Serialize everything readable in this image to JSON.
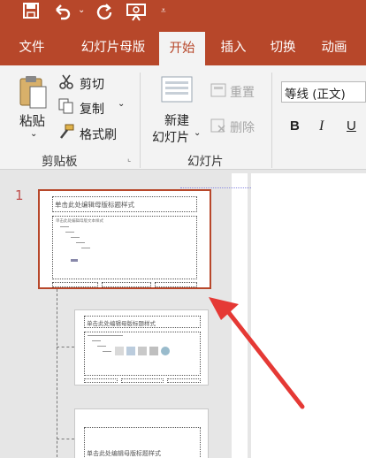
{
  "tabs": [
    "文件",
    "幻灯片母版",
    "开始",
    "插入",
    "切换",
    "动画"
  ],
  "clipboard": {
    "paste": "粘贴",
    "cut": "剪切",
    "copy": "复制",
    "format_painter": "格式刷",
    "group_label": "剪贴板"
  },
  "slides": {
    "new_slide_line1": "新建",
    "new_slide_line2": "幻灯片",
    "reset": "重置",
    "delete": "删除",
    "group_label": "幻灯片"
  },
  "font": {
    "name": "等线 (正文)",
    "bold": "B",
    "italic": "I",
    "underline": "U"
  },
  "thumbnail_1": {
    "number": "1",
    "title": "单击此处编辑母版标题样式",
    "body": "单击此处编辑母版文本样式"
  },
  "thumbnail_2": {
    "title": "单击此处编辑母版标题样式"
  },
  "thumbnail_3": {
    "title": "单击此处编辑母版标题样式"
  },
  "colors": {
    "accent": "#b7472a",
    "arrow": "#e53935"
  }
}
